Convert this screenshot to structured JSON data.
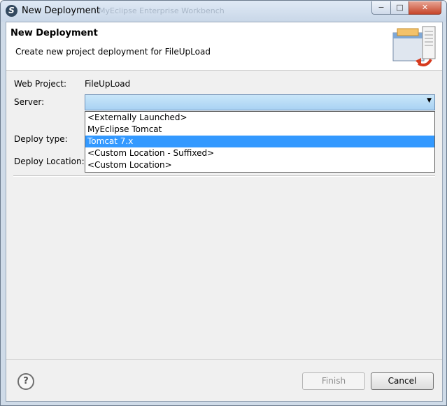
{
  "window": {
    "title": "New Deployment",
    "background_title": "MyEclipse Enterprise Workbench",
    "controls": {
      "minimize": "−",
      "maximize": "□",
      "close": "✕"
    }
  },
  "header": {
    "title": "New Deployment",
    "description": "Create new project deployment for FileUpLoad"
  },
  "form": {
    "web_project_label": "Web Project:",
    "web_project_value": "FileUpLoad",
    "server_label": "Server:",
    "server_value": "",
    "deploy_type_label": "Deploy type:",
    "deploy_location_label": "Deploy Location:"
  },
  "dropdown": {
    "options": [
      "<Externally Launched>",
      "MyEclipse Tomcat",
      "Tomcat  7.x",
      "<Custom Location - Suffixed>",
      "<Custom Location>"
    ],
    "selected_index": 2
  },
  "footer": {
    "help": "?",
    "finish_label": "Finish",
    "cancel_label": "Cancel"
  },
  "colors": {
    "selection": "#3399ff",
    "combo_focus": "#a9d2f3"
  },
  "icons": {
    "app": "myeclipse-icon",
    "wizard": "deployment-wizard-icon",
    "help": "help-icon",
    "dropdown": "chevron-down-icon"
  }
}
